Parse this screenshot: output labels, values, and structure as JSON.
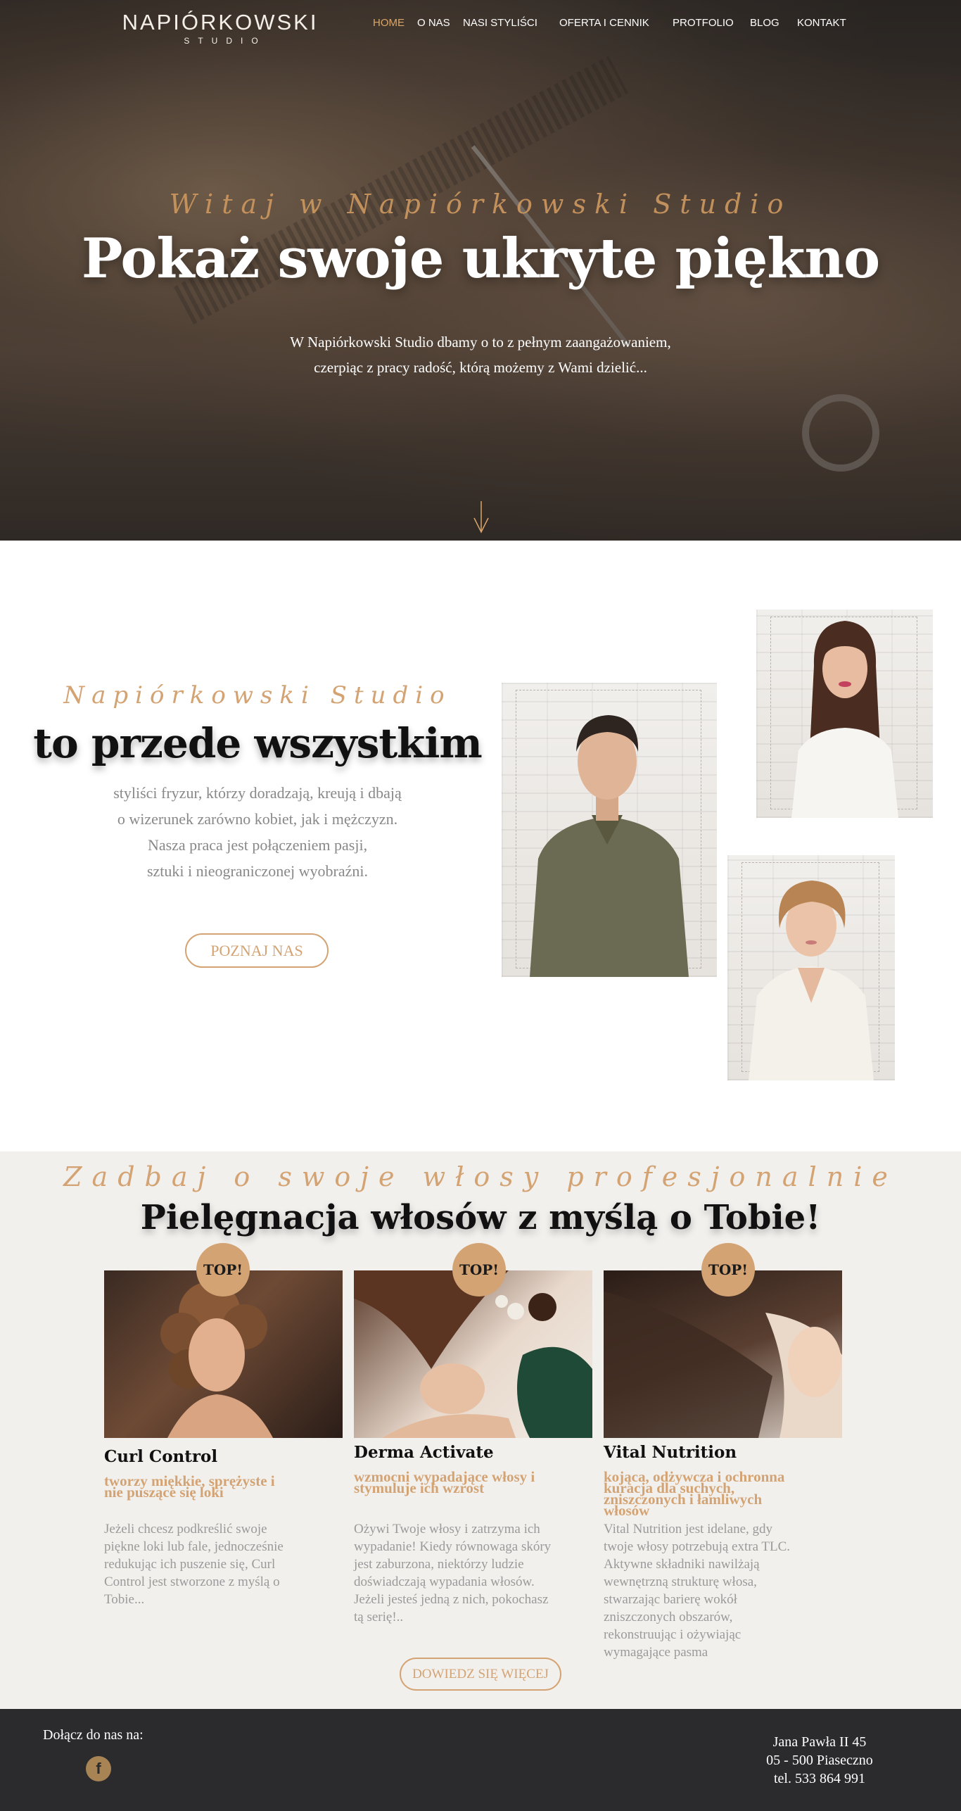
{
  "brand": {
    "logo_main": "NAPIÓRKOWSKI",
    "logo_sub": "STUDIO",
    "accent_color": "#d4a373",
    "dark_color": "#2b2a2d"
  },
  "nav": {
    "items": [
      {
        "label": "HOME",
        "active": true
      },
      {
        "label": "O NAS"
      },
      {
        "label": "NASI STYLIŚCI"
      },
      {
        "label": "OFERTA I CENNIK"
      },
      {
        "label": "PROTFOLIO"
      },
      {
        "label": "BLOG"
      },
      {
        "label": "KONTAKT"
      }
    ]
  },
  "hero": {
    "script": "Witaj w Napiórkowski Studio",
    "title": "Pokaż swoje ukryte piękno",
    "desc_line1": "W Napiórkowski Studio dbamy o to z pełnym zaangażowaniem,",
    "desc_line2": "czerpiąc z pracy radość, którą możemy z Wami dzielić...",
    "scroll_icon": "arrow-down-icon"
  },
  "about": {
    "script": "Napiórkowski Studio",
    "title": "to przede wszystkim",
    "lines": [
      "styliści fryzur, którzy doradzają, kreują i dbają",
      "o wizerunek zarówno kobiet, jak i mężczyzn.",
      "Nasza praca jest połączeniem pasji,",
      "sztuki i nieograniczonej wyobraźni."
    ],
    "button": "POZNAJ NAS"
  },
  "care": {
    "script": "Zadbaj o swoje włosy profesjonalnie",
    "title": "Pielęgnacja włosów z myślą o Tobie!",
    "badge": "TOP!",
    "cards": [
      {
        "name": "Curl Control",
        "sub_lines": [
          "tworzy miękkie, sprężyste i",
          "nie puszące się loki"
        ],
        "desc_lines": [
          "Jeżeli chcesz podkreślić swoje",
          "piękne loki lub fale, jednocześnie",
          "redukując ich puszenie się, Curl",
          "Control jest stworzone z myślą o",
          "Tobie..."
        ]
      },
      {
        "name": "Derma Activate",
        "sub_lines": [
          "wzmocni wypadające włosy i",
          "stymuluje ich wzrost"
        ],
        "desc_lines": [
          "Ożywi Twoje włosy i zatrzyma ich",
          "wypadanie! Kiedy równowaga skóry",
          "jest zaburzona, niektórzy ludzie",
          "doświadczają wypadania włosów.",
          "Jeżeli jesteś jedną z nich, pokochasz",
          "tą serię!.."
        ]
      },
      {
        "name": "Vital Nutrition",
        "sub_lines": [
          "kojąca, odżywcza i ochronna",
          "kuracja dla suchych,",
          "zniszczonych i łamliwych",
          "włosów"
        ],
        "desc_lines": [
          "Vital Nutrition jest idelane, gdy",
          "twoje włosy potrzebują extra TLC.",
          "Aktywne składniki nawilżają",
          "wewnętrzną strukturę włosa,",
          "stwarzając barierę wokół",
          "zniszczonych obszarów,",
          "rekonstruując i ożywiając",
          "wymagające pasma"
        ]
      }
    ],
    "button": "DOWIEDZ SIĘ WIĘCEJ"
  },
  "footer": {
    "join": "Dołącz do nas na:",
    "social_icon": "facebook-icon",
    "address_line1": "Jana Pawła II 45",
    "address_line2": "05 - 500 Piaseczno",
    "phone": "tel. 533 864 991"
  }
}
